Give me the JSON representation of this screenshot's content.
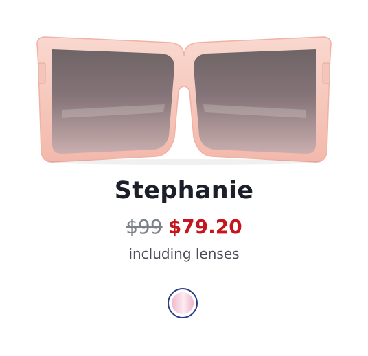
{
  "product": {
    "name": "Stephanie",
    "image_alt": "Stephanie sunglasses in crystal pink",
    "price_original": "$99",
    "price_sale": "$79.20",
    "price_note": "including lenses"
  },
  "swatches": [
    {
      "color_name": "crystal pink",
      "color": "#f4c3d3",
      "selected": true
    }
  ],
  "colors": {
    "sale_price": "#c4161c",
    "original_price": "#7d8289",
    "name_text": "#1c1f2a",
    "selected_swatch_ring": "#2d3a8c",
    "frame": "#f6c3b8",
    "lens": "#7b6a6a"
  }
}
